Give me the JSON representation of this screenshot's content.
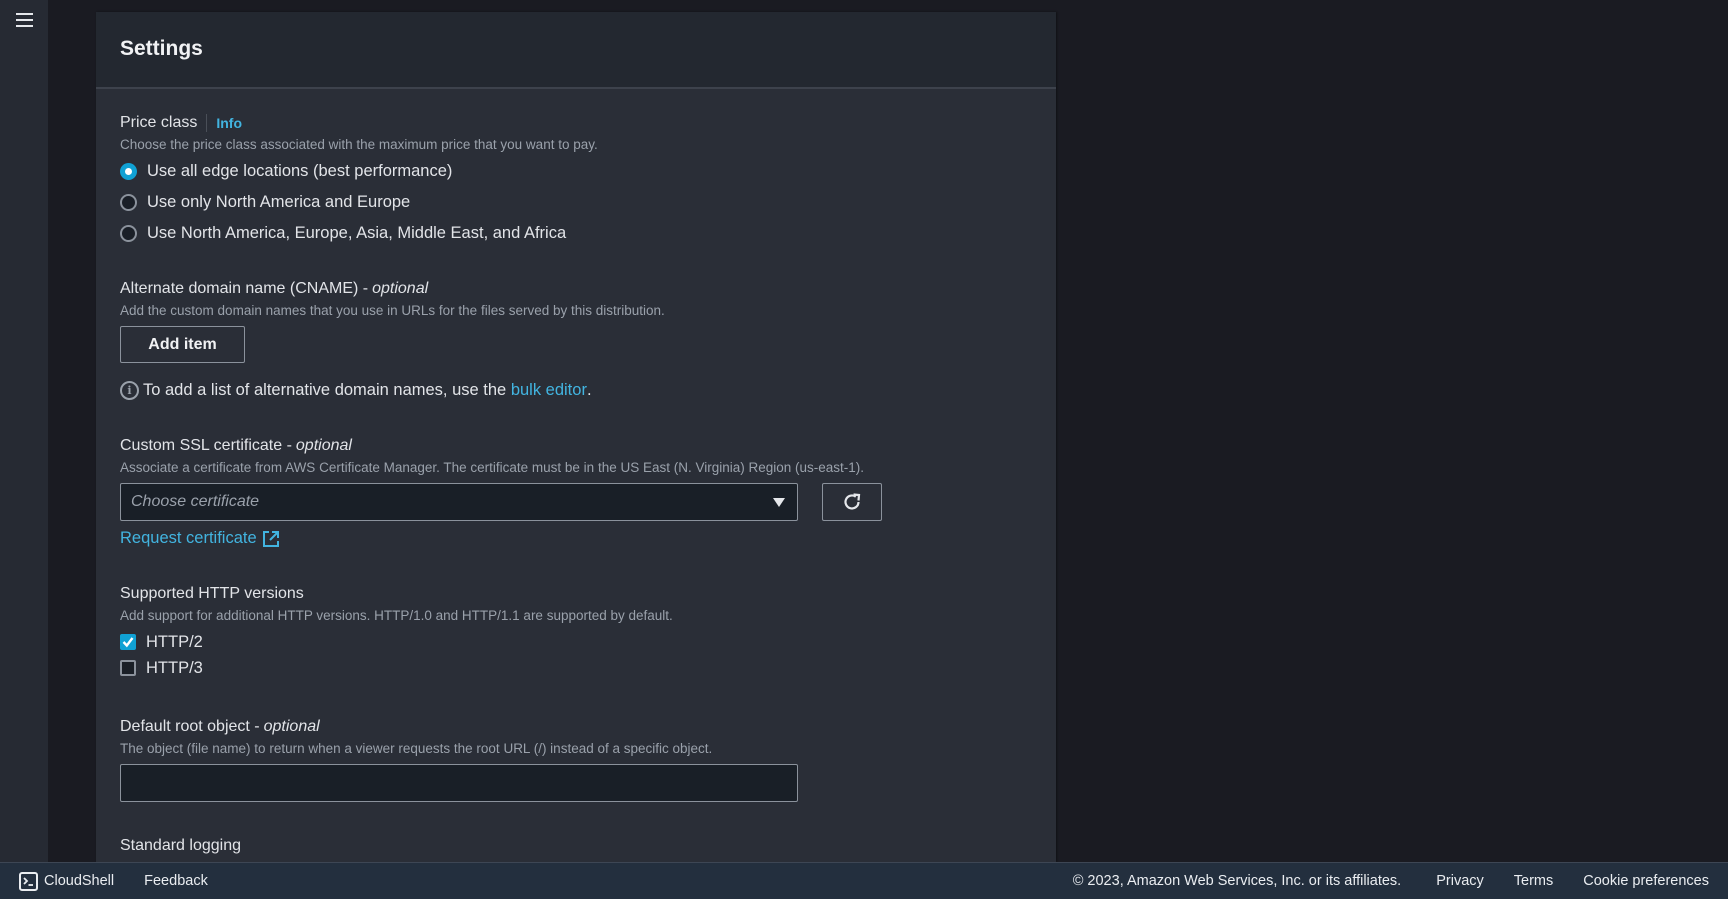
{
  "nav": {
    "menu_icon": "hamburger-menu-icon"
  },
  "panel": {
    "title": "Settings",
    "price_class": {
      "label": "Price class",
      "info": "Info",
      "description": "Choose the price class associated with the maximum price that you want to pay.",
      "options": [
        {
          "label": "Use all edge locations (best performance)",
          "checked": true
        },
        {
          "label": "Use only North America and Europe",
          "checked": false
        },
        {
          "label": "Use North America, Europe, Asia, Middle East, and Africa",
          "checked": false
        }
      ]
    },
    "cname": {
      "label": "Alternate domain name (CNAME) -",
      "optional": "optional",
      "description": "Add the custom domain names that you use in URLs for the files served by this distribution.",
      "add_button": "Add item",
      "info_text": "To add a list of alternative domain names, use the",
      "bulk_link": "bulk editor",
      "period": "."
    },
    "ssl": {
      "label": "Custom SSL certificate -",
      "optional": "optional",
      "description": "Associate a certificate from AWS Certificate Manager. The certificate must be in the US East (N. Virginia) Region (us-east-1).",
      "placeholder": "Choose certificate",
      "request_link": "Request certificate"
    },
    "http": {
      "label": "Supported HTTP versions",
      "description": "Add support for additional HTTP versions. HTTP/1.0 and HTTP/1.1 are supported by default.",
      "options": [
        {
          "label": "HTTP/2",
          "checked": true
        },
        {
          "label": "HTTP/3",
          "checked": false
        }
      ]
    },
    "root_object": {
      "label": "Default root object -",
      "optional": "optional",
      "description": "The object (file name) to return when a viewer requests the root URL (/) instead of a specific object.",
      "value": ""
    },
    "logging": {
      "label": "Standard logging"
    }
  },
  "footer": {
    "cloudshell": "CloudShell",
    "feedback": "Feedback",
    "copyright": "© 2023, Amazon Web Services, Inc. or its affiliates.",
    "privacy": "Privacy",
    "terms": "Terms",
    "cookies": "Cookie preferences"
  },
  "colors": {
    "accent": "#10a1d4",
    "link": "#42b4e0",
    "footer_bg": "#232f3e"
  }
}
